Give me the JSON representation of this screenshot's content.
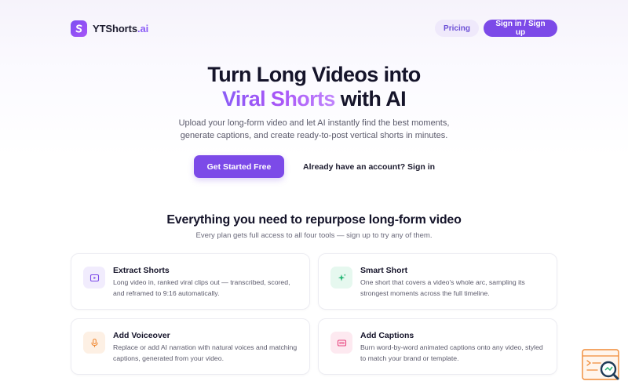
{
  "brand": {
    "name": "YTShorts",
    "tld": ".ai"
  },
  "nav": {
    "pricing": "Pricing",
    "signin": "Sign in / Sign up"
  },
  "hero": {
    "title_line1": "Turn Long Videos into",
    "title_highlight": "Viral Shorts",
    "title_line2_rest": " with AI",
    "subtitle_line1": "Upload your long-form video and let AI instantly find the best moments,",
    "subtitle_line2": "generate captions, and create ready-to-post vertical shorts in minutes.",
    "cta_primary": "Get Started Free",
    "cta_secondary": "Already have an account? Sign in"
  },
  "features": {
    "title": "Everything you need to repurpose long-form video",
    "subtitle": "Every plan gets full access to all four tools — sign up to try any of them.",
    "items": [
      {
        "title": "Extract Shorts",
        "desc": "Long video in, ranked viral clips out — transcribed, scored, and reframed to 9:16 automatically.",
        "icon": "video-clip-icon",
        "color": "#7c4ae8"
      },
      {
        "title": "Smart Short",
        "desc": "One short that covers a video's whole arc, sampling its strongest moments across the full timeline.",
        "icon": "sparkle-icon",
        "color": "#22b573"
      },
      {
        "title": "Add Voiceover",
        "desc": "Replace or add AI narration with natural voices and matching captions, generated from your video.",
        "icon": "microphone-icon",
        "color": "#f08a35"
      },
      {
        "title": "Add Captions",
        "desc": "Burn word-by-word animated captions onto any video, styled to match your brand or template.",
        "icon": "captions-icon",
        "color": "#e8457f"
      }
    ]
  },
  "colors": {
    "accent": "#7c4ae8",
    "accent_light": "#efe9fb",
    "text": "#15142a",
    "muted": "#5b5a6b"
  }
}
